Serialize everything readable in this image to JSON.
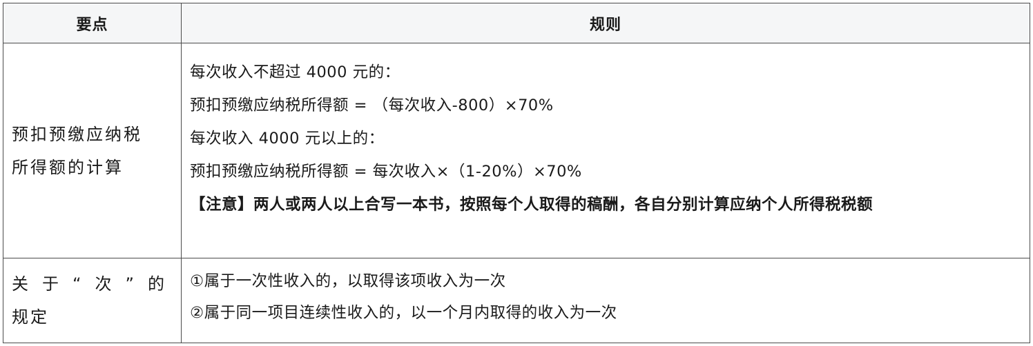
{
  "header": {
    "col1": "要点",
    "col2": "规则"
  },
  "rows": [
    {
      "point_lines": [
        "预扣预缴应纳税",
        "所得额的计算"
      ],
      "rules": [
        "每次收入不超过 4000 元的：",
        "预扣预缴应纳税所得额 = （每次收入-800）×70%",
        "每次收入 4000 元以上的：",
        "预扣预缴应纳税所得额 = 每次收入×（1-20%）×70%",
        "【注意】两人或两人以上合写一本书，按照每个人取得的稿酬，各自分别计算应纳个人所得税税额"
      ]
    },
    {
      "point_line1_parts": [
        "关",
        "于",
        "“",
        "次",
        "”",
        "的"
      ],
      "point_line2": "规定",
      "rules": [
        "①属于一次性收入的，以取得该项收入为一次",
        "②属于同一项目连续性收入的，以一个月内取得的收入为一次"
      ]
    }
  ]
}
